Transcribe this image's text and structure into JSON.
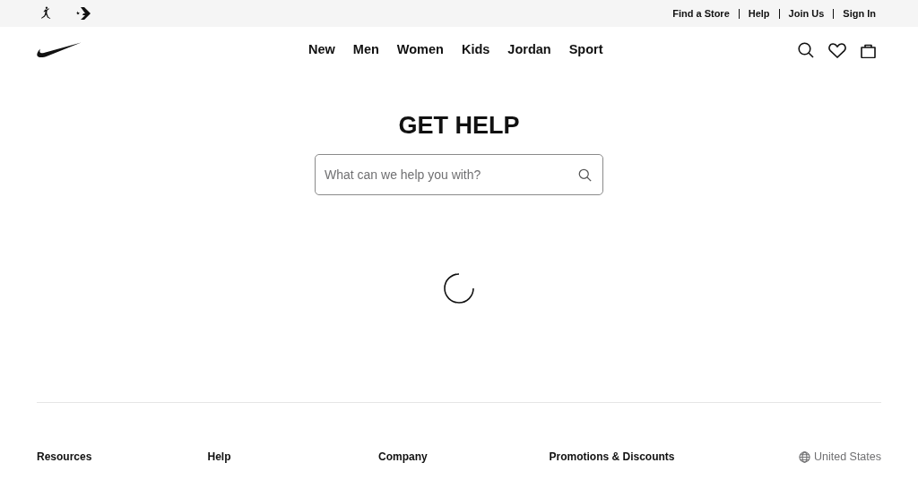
{
  "utility_bar": {
    "links": [
      "Find a Store",
      "Help",
      "Join Us",
      "Sign In"
    ]
  },
  "nav": {
    "items": [
      "New",
      "Men",
      "Women",
      "Kids",
      "Jordan",
      "Sport"
    ]
  },
  "title": "GET HELP",
  "search": {
    "placeholder": "What can we help you with?"
  },
  "footer": {
    "columns": [
      "Resources",
      "Help",
      "Company",
      "Promotions & Discounts"
    ],
    "locale": "United States"
  }
}
